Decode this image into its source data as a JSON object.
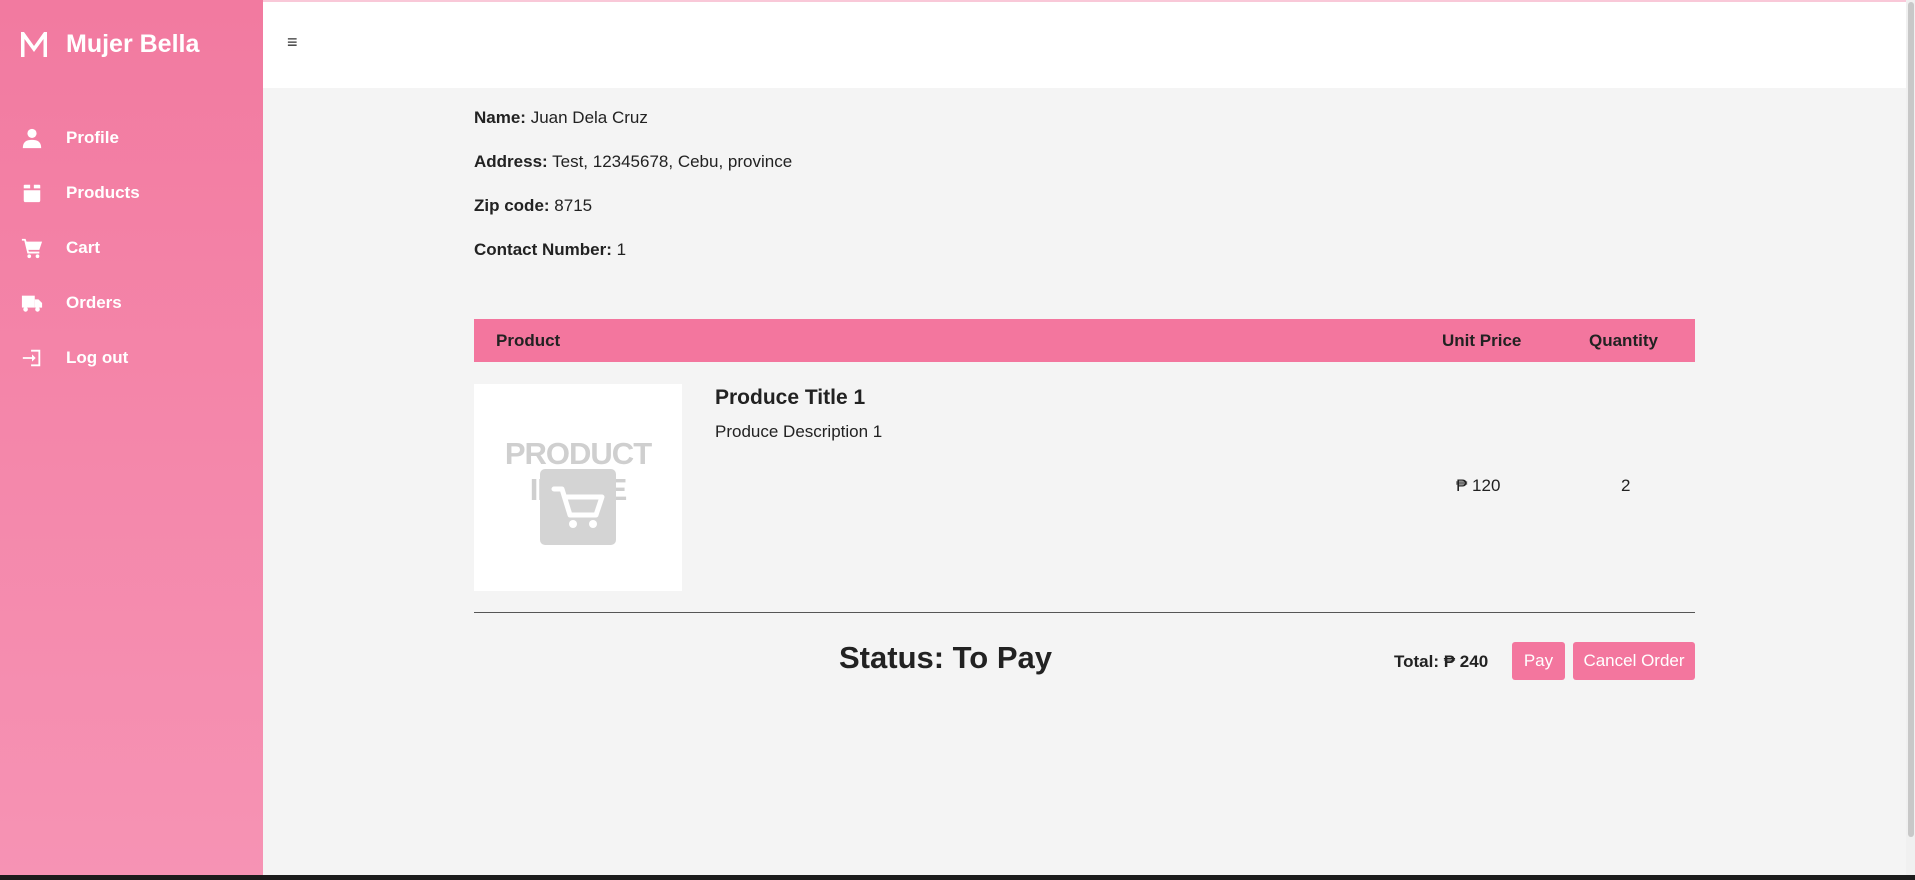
{
  "brand": {
    "name": "Mujer Bella",
    "logo_icon": "m-logo-icon",
    "color": "#f27aa0"
  },
  "sidebar": {
    "items": [
      {
        "label": "Profile",
        "icon": "user-icon"
      },
      {
        "label": "Products",
        "icon": "box-icon"
      },
      {
        "label": "Cart",
        "icon": "cart-icon"
      },
      {
        "label": "Orders",
        "icon": "truck-icon"
      },
      {
        "label": "Log out",
        "icon": "logout-icon"
      }
    ]
  },
  "header": {
    "menu_glyph": "≡",
    "menu_icon": "hamburger-icon"
  },
  "customer": {
    "name_label": "Name:",
    "name": "Juan Dela Cruz",
    "address_label": "Address:",
    "address": "Test, 12345678, Cebu, province",
    "zip_label": "Zip code:",
    "zip": "8715",
    "contact_label": "Contact Number:",
    "contact": "1"
  },
  "table": {
    "headers": {
      "product": "Product",
      "unit_price": "Unit Price",
      "quantity": "Quantity"
    },
    "rows": [
      {
        "image_text": "PRODUCT IMAGE",
        "title": "Produce Title 1",
        "description": "Produce Description 1",
        "unit_price": "₱ 120",
        "quantity": "2"
      }
    ]
  },
  "order": {
    "status": "Status: To Pay",
    "total": "Total: ₱ 240",
    "pay_label": "Pay",
    "cancel_label": "Cancel Order",
    "accent_color": "#f3769e"
  }
}
